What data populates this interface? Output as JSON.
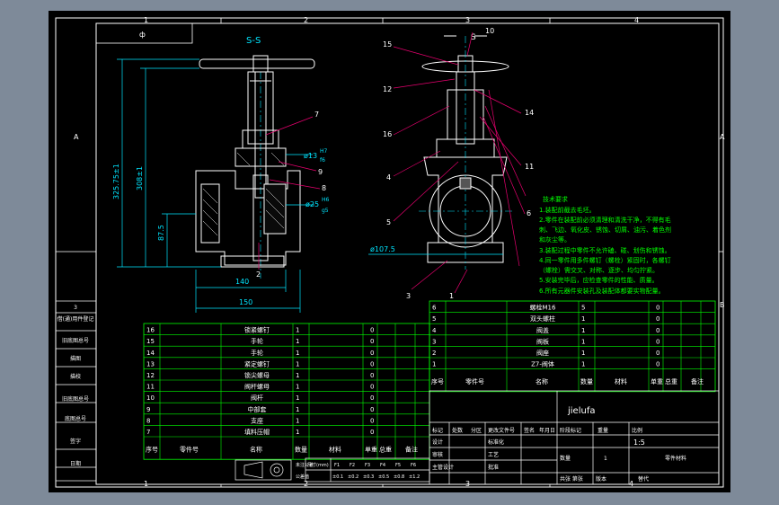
{
  "background": "#7e8a99",
  "paper": "#000000",
  "colors": {
    "line": "#ffffff",
    "table": "#00ff00",
    "dim": "#00e5ff",
    "part": "#ffffff",
    "leader": "#e6006e",
    "notes": "#00ff00"
  },
  "border": {
    "top_zones": [
      "1",
      "2",
      "3",
      "4"
    ],
    "bottom_zones": [
      "1",
      "2",
      "3",
      "4"
    ],
    "left_zones": [
      "A",
      "B"
    ],
    "right_zones": [
      "A",
      "B"
    ]
  },
  "corner_box": {
    "text": "ф"
  },
  "section_label": "S-S",
  "s_view_label": "S",
  "left_view": {
    "dim_total": "325.75±1",
    "dim_mid": "308±1",
    "dim_low": "87.5",
    "dim_140": "140",
    "dim_150": "150",
    "fit1": "ø13",
    "fit1_tol": "H7",
    "fit1_sub": "f6",
    "fit2": "ø25",
    "fit2_tol": "H6",
    "fit2_sub": "g5",
    "balloons": [
      "7",
      "9",
      "8",
      "2"
    ]
  },
  "right_view": {
    "dia": "ø107.5",
    "balloons": [
      "15",
      "10",
      "12",
      "14",
      "16",
      "11",
      "4",
      "5",
      "3",
      "6",
      "1"
    ]
  },
  "notes": {
    "title": "技术要求",
    "lines": [
      "1.装配前截去毛坯。",
      "2.零件在装配前必须清理和清洗干净，不得有毛",
      "刺、飞边、氧化皮、锈蚀、切屑、油污、着色剂",
      "和灰尘等。",
      "3.装配过程中零件不允许磕、碰、划伤和锈蚀。",
      "4.同一零件用多件螺钉（螺栓）紧固时，各螺钉",
      "（螺栓）需交叉、对称、逐步、均匀拧紧。",
      "5.安装完毕后，应检查零件的性能、质量。",
      "6.所有元器件安装孔及装配体都要实物配量。"
    ]
  },
  "bom_left": {
    "rows": [
      {
        "no": "16",
        "name": "锁紧螺钉",
        "qty": "1",
        "w": "0"
      },
      {
        "no": "15",
        "name": "手轮",
        "qty": "1",
        "w": "0"
      },
      {
        "no": "14",
        "name": "手轮",
        "qty": "1",
        "w": "0"
      },
      {
        "no": "13",
        "name": "紧定螺钉",
        "qty": "1",
        "w": "0"
      },
      {
        "no": "12",
        "name": "锁尖螺母",
        "qty": "1",
        "w": "0"
      },
      {
        "no": "11",
        "name": "阀杆螺母",
        "qty": "1",
        "w": "0"
      },
      {
        "no": "10",
        "name": "阀杆",
        "qty": "1",
        "w": "0"
      },
      {
        "no": "9",
        "name": "中部套",
        "qty": "1",
        "w": "0"
      },
      {
        "no": "8",
        "name": "支座",
        "qty": "1",
        "w": "0"
      },
      {
        "no": "7",
        "name": "填料压帽",
        "qty": "1",
        "w": "0"
      }
    ],
    "header": {
      "no": "序号",
      "code": "零件号",
      "name": "名称",
      "qty": "数量",
      "mat": "材料",
      "w": "单重",
      "tot": "总重",
      "note": "备注"
    }
  },
  "bom_right": {
    "rows": [
      {
        "no": "6",
        "name": "螺栓M16",
        "qty": "5",
        "w": "0"
      },
      {
        "no": "5",
        "name": "双头螺柱",
        "qty": "1",
        "w": "0"
      },
      {
        "no": "4",
        "name": "阀盖",
        "qty": "1",
        "w": "0"
      },
      {
        "no": "3",
        "name": "阀板",
        "qty": "1",
        "w": "0"
      },
      {
        "no": "2",
        "name": "阀座",
        "qty": "1",
        "w": "0"
      },
      {
        "no": "1",
        "name": "Z7-阀体",
        "qty": "1",
        "w": "0"
      }
    ],
    "header": {
      "no": "序号",
      "code": "零件号",
      "name": "名称",
      "qty": "数量",
      "mat": "材料",
      "w": "单重",
      "tot": "总重",
      "note": "备注"
    }
  },
  "title_block": {
    "drawing_name": "jielufa",
    "scale": "1:5",
    "labels": {
      "mark": "标记",
      "count": "处数",
      "zone": "分区",
      "doc": "更改文件号",
      "sign": "签名",
      "date": "年月日",
      "design": "设计",
      "std": "标准化",
      "check": "审核",
      "craft": "工艺",
      "approve": "批准",
      "mgr": "主管设计",
      "stage": "阶段标记",
      "weight": "重量",
      "ratio": "比例",
      "sheets": "共张 第张",
      "version": "版本",
      "replace": "替代",
      "qty_lbl": "数量",
      "qty_val": "1",
      "partcode": "零件材料"
    }
  },
  "left_strip": {
    "items": [
      "3",
      "借(通)用件登记",
      "旧底图总号",
      "描图",
      "描校",
      "旧底图总号",
      "底图总号",
      "签字",
      "日期"
    ]
  },
  "tolerance": {
    "head": [
      "尺寸(mm)",
      "F1",
      "F2",
      "F3",
      "F4",
      "F5",
      "F6"
    ],
    "vals": [
      "±0.1",
      "±0.2",
      "±0.3",
      "±0.5",
      "±0.8",
      "±1.2"
    ],
    "label1": "未注公差",
    "label2": "公差值"
  }
}
